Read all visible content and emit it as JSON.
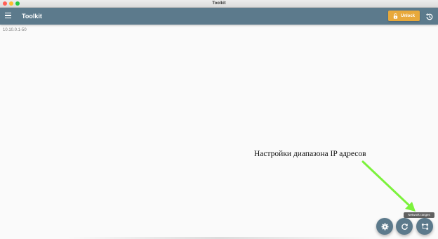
{
  "window": {
    "title": "Toolkit"
  },
  "appbar": {
    "title": "Toolkit",
    "menu_icon": "hamburger-menu-icon",
    "unlock_label": "Unlock",
    "unlock_icon": "lock-open-icon",
    "history_icon": "history-icon",
    "color": "#5c7a8c"
  },
  "main": {
    "range_text": "10.10.0.1-50"
  },
  "annotation": {
    "text": "Настройки диапазона IP адресов",
    "arrow_color": "#7cf23c"
  },
  "tooltip": {
    "text": "Network ranges"
  },
  "fabs": {
    "settings_icon": "gear-icon",
    "refresh_icon": "refresh-icon",
    "network_icon": "network-ranges-icon"
  },
  "colors": {
    "accent": "#e8a93b",
    "primary": "#5c7a8c"
  }
}
